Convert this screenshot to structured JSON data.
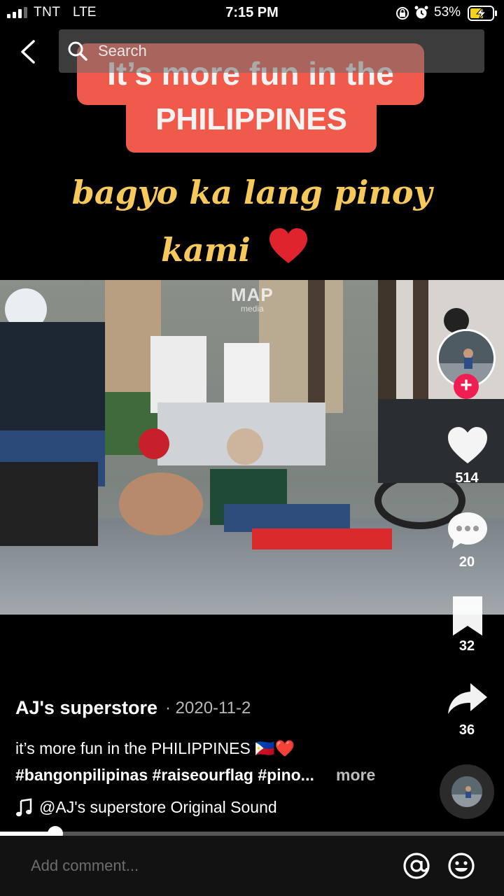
{
  "status_bar": {
    "carrier": "TNT",
    "network": "LTE",
    "time": "7:15 PM",
    "battery_percent": "53%",
    "signal_bars": 3,
    "icons": [
      "signal-icon",
      "rotation-lock-icon",
      "alarm-icon",
      "battery-charging-icon"
    ]
  },
  "top_bar": {
    "back_icon": "chevron-left-icon",
    "search_placeholder": "Search"
  },
  "video": {
    "caption_line1": "It’s more fun in the",
    "caption_line2": "PHILIPPINES",
    "script_line1": "bagyo ka lang pinoy",
    "script_line2": "kami",
    "watermark": "MAP",
    "watermark_sub": "media"
  },
  "rail": {
    "likes": "514",
    "comments": "20",
    "saves": "32",
    "shares": "36"
  },
  "post": {
    "author": "AJ's superstore",
    "date": "· 2020-11-2",
    "description": "it’s more fun in the PHILIPPINES 🇵🇭❤️",
    "hashtags": "#bangonpilipinas #raiseourflag #pino...",
    "more_label": "more",
    "sound": "@AJ's superstore Original Sound"
  },
  "progress": {
    "fraction": 0.11
  },
  "comment_bar": {
    "placeholder": "Add comment..."
  },
  "colors": {
    "accent_pink": "#ee1d52",
    "caption_red": "#f05a4a",
    "script_gold": "#f6c95a"
  }
}
